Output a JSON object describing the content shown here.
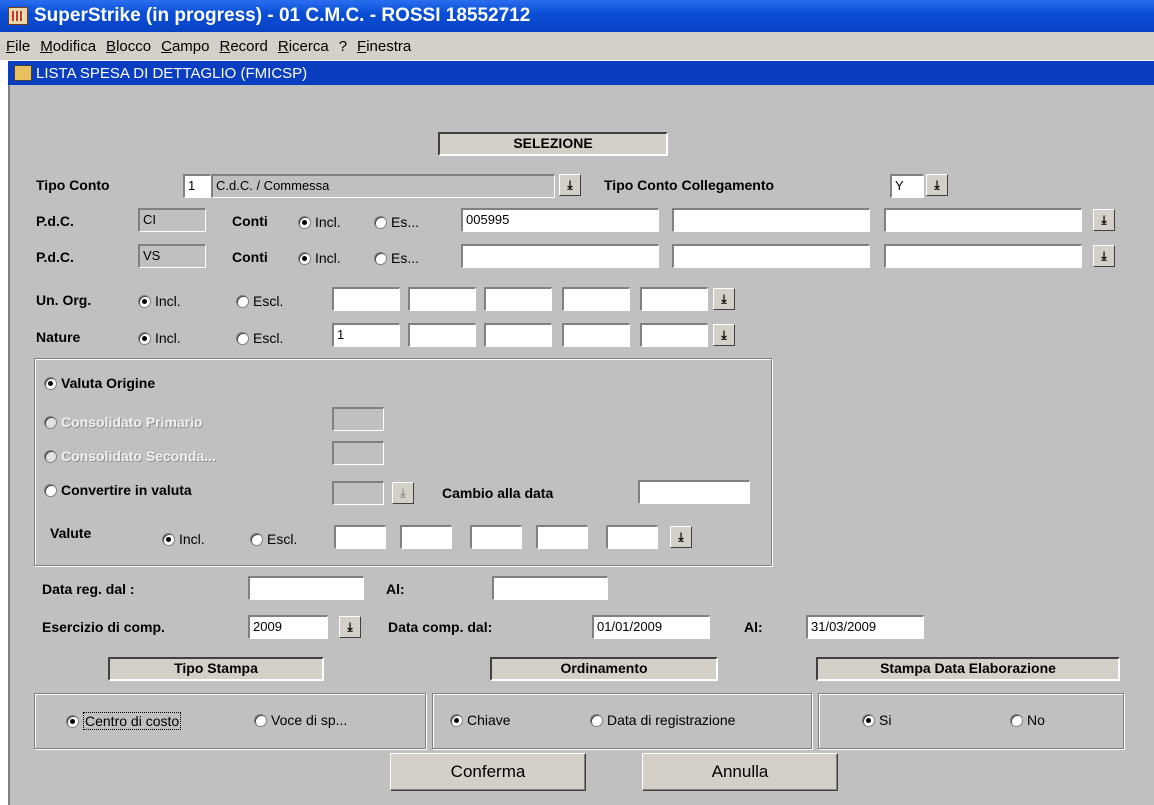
{
  "window": {
    "title": "SuperStrike (in progress) - 01 C.M.C. - ROSSI 18552712"
  },
  "menu": [
    "File",
    "Modifica",
    "Blocco",
    "Campo",
    "Record",
    "Ricerca",
    "?",
    "Finestra"
  ],
  "form_title": "LISTA SPESA DI DETTAGLIO (FMICSP)",
  "selezione": "SELEZIONE",
  "tipo_conto": {
    "label": "Tipo Conto",
    "code": "1",
    "desc": "C.d.C. / Commessa"
  },
  "tipo_conto_coll": {
    "label": "Tipo Conto Collegamento",
    "value": "Y"
  },
  "pdc1": {
    "label": "P.d.C.",
    "value": "CI",
    "conti": "Conti",
    "incl": "Incl.",
    "escl": "Es...",
    "f1": "005995",
    "f2": "",
    "f3": ""
  },
  "pdc2": {
    "label": "P.d.C.",
    "value": "VS",
    "conti": "Conti",
    "incl": "Incl.",
    "escl": "Es...",
    "f1": "",
    "f2": "",
    "f3": ""
  },
  "unorg": {
    "label": "Un. Org.",
    "incl": "Incl.",
    "escl": "Escl.",
    "values": [
      "",
      "",
      "",
      "",
      "",
      ""
    ]
  },
  "nature": {
    "label": "Nature",
    "incl": "Incl.",
    "escl": "Escl.",
    "values": [
      "1",
      "",
      "",
      "",
      "",
      ""
    ]
  },
  "valuta": {
    "origine": "Valuta Origine",
    "cons_primario": "Consolidato Primario",
    "cons_secondario": "Consolidato Seconda...",
    "convertire": "Convertire in valuta",
    "cambio": "Cambio alla data",
    "cambio_value": "",
    "valute": "Valute",
    "incl": "Incl.",
    "escl": "Escl."
  },
  "data_reg": {
    "label": "Data reg. dal :",
    "dal": "",
    "al_label": "Al:",
    "al": ""
  },
  "esercizio": {
    "label": "Esercizio di comp.",
    "value": "2009",
    "dal_label": "Data comp. dal:",
    "dal": "01/01/2009",
    "al_label": "Al:",
    "al": "31/03/2009"
  },
  "tipo_stampa": {
    "title": "Tipo Stampa",
    "opt1": "Centro di costo",
    "opt2": "Voce di sp..."
  },
  "ordinamento": {
    "title": "Ordinamento",
    "opt1": "Chiave",
    "opt2": "Data di registrazione"
  },
  "stampa_data": {
    "title": "Stampa Data Elaborazione",
    "opt1": "Si",
    "opt2": "No"
  },
  "buttons": {
    "confirm": "Conferma",
    "cancel": "Annulla"
  },
  "lov_glyph": "⤓",
  "colors": {
    "titlebar": "#0a4fd6",
    "form_bg": "#c0c0c0",
    "subbar": "#0a3ec0"
  }
}
